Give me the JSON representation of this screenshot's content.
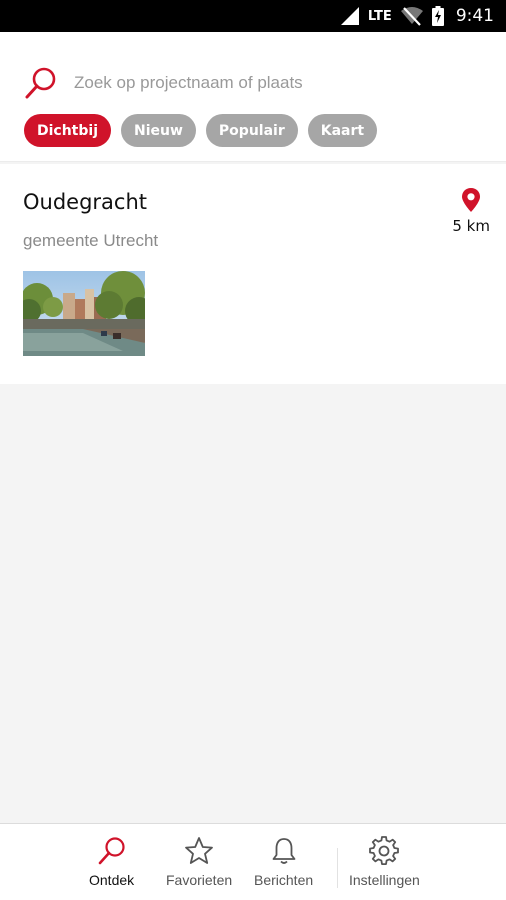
{
  "status_bar": {
    "network": "LTE",
    "time": "9:41"
  },
  "search": {
    "placeholder": "Zoek op projectnaam of plaats",
    "value": ""
  },
  "filters": [
    {
      "label": "Dichtbij",
      "active": true
    },
    {
      "label": "Nieuw",
      "active": false
    },
    {
      "label": "Populair",
      "active": false
    },
    {
      "label": "Kaart",
      "active": false
    }
  ],
  "results": [
    {
      "title": "Oudegracht",
      "subtitle": "gemeente Utrecht",
      "distance": "5 km"
    }
  ],
  "bottom_nav": [
    {
      "label": "Ontdek",
      "icon": "search-icon",
      "active": true
    },
    {
      "label": "Favorieten",
      "icon": "star-icon",
      "active": false
    },
    {
      "label": "Berichten",
      "icon": "bell-icon",
      "active": false
    },
    {
      "label": "Instellingen",
      "icon": "gear-icon",
      "active": false
    }
  ],
  "colors": {
    "accent": "#d0132a",
    "chip_inactive": "#a6a6a6",
    "background": "#f4f4f4"
  }
}
